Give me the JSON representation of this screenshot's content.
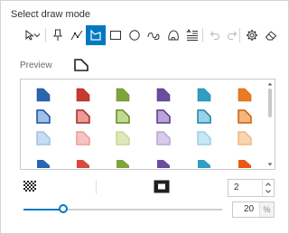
{
  "title": "Select draw mode",
  "toolbar": {
    "tools": [
      {
        "name": "select-arrow-icon",
        "active": false
      },
      {
        "name": "chevron-down-icon",
        "active": false
      },
      {
        "name": "pushpin-icon",
        "active": false
      },
      {
        "name": "polyline-icon",
        "active": false
      },
      {
        "name": "polygon-icon",
        "active": true
      },
      {
        "name": "rectangle-icon",
        "active": false
      },
      {
        "name": "circle-icon",
        "active": false
      },
      {
        "name": "freehand-polyline-icon",
        "active": false
      },
      {
        "name": "freehand-polygon-icon",
        "active": false
      },
      {
        "name": "text-icon",
        "active": false
      },
      {
        "name": "undo-icon",
        "active": false
      },
      {
        "name": "redo-icon",
        "active": false
      },
      {
        "name": "settings-icon",
        "active": false
      },
      {
        "name": "eraser-icon",
        "active": false
      }
    ]
  },
  "preview_label": "Preview",
  "swatches": {
    "columns": [
      {
        "fill": "#2a66b0",
        "stroke": "#1a4f94",
        "light": "#9fc1e9",
        "pale": "#c8dcf4"
      },
      {
        "fill": "#c7392f",
        "stroke": "#a12a22",
        "light": "#ef9a94",
        "pale": "#f6c4c0"
      },
      {
        "fill": "#7fa43a",
        "stroke": "#648a26",
        "light": "#c2da8e",
        "pale": "#dceab9"
      },
      {
        "fill": "#6b4c9e",
        "stroke": "#553a86",
        "light": "#bba4d9",
        "pale": "#d8cbea"
      },
      {
        "fill": "#2e9fc3",
        "stroke": "#1f80a3",
        "light": "#97d2e8",
        "pale": "#c6e7f3"
      },
      {
        "fill": "#ea7a1f",
        "stroke": "#c6600e",
        "light": "#f6b57c",
        "pale": "#fad4b1"
      }
    ],
    "bottom_row": [
      "#2a66b0",
      "#d9493e",
      "#7fa43a",
      "#6b4c9e",
      "#2e9fc3",
      "#e85a14"
    ]
  },
  "stroke_width": "2",
  "opacity_value": "20",
  "opacity_suffix": "%",
  "opacity_slider_fraction": 0.2
}
